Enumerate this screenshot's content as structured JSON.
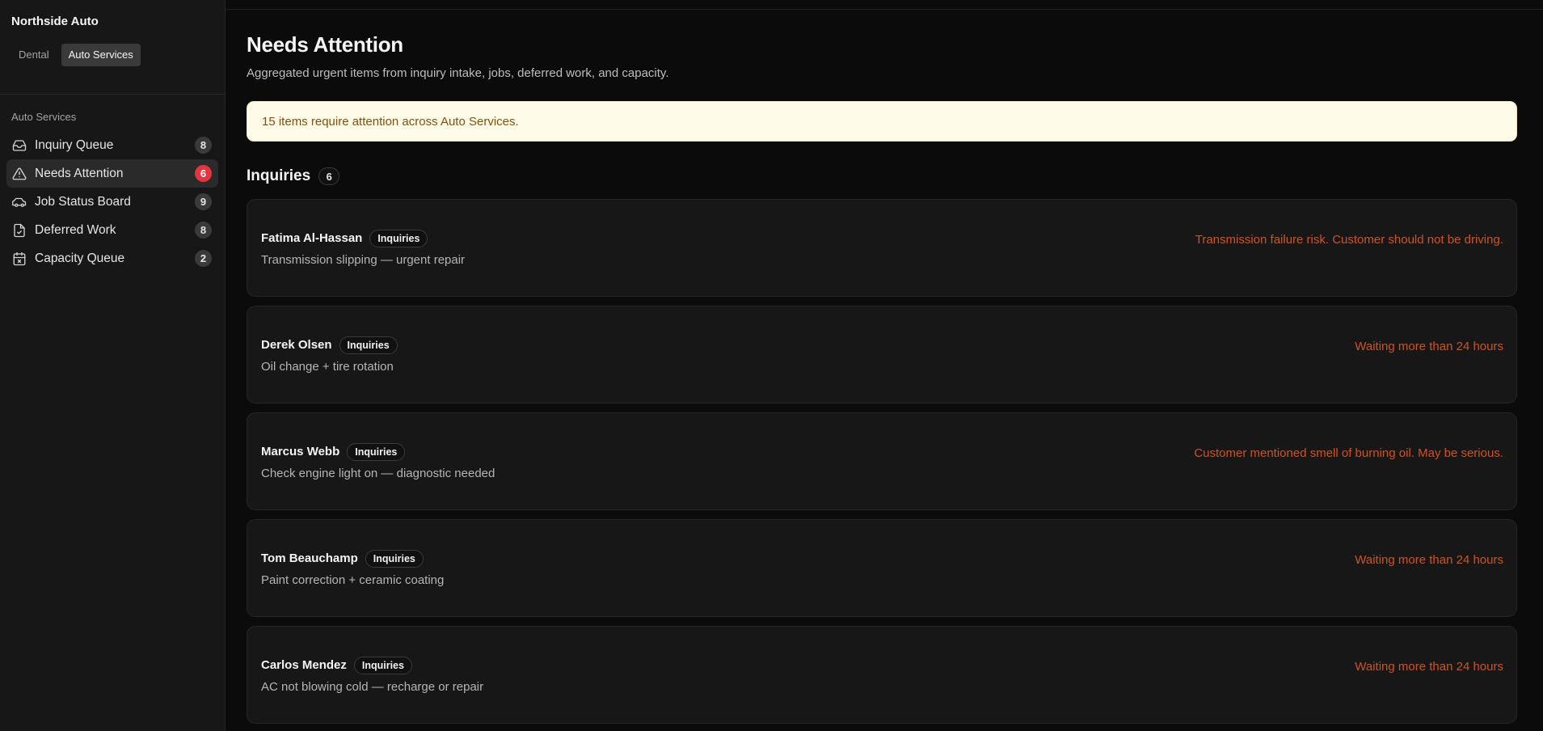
{
  "sidebar": {
    "brand": "Northside Auto",
    "switcher": [
      {
        "label": "Dental",
        "active": false
      },
      {
        "label": "Auto Services",
        "active": true
      }
    ],
    "group_label": "Auto Services",
    "items": [
      {
        "label": "Inquiry Queue",
        "count": "8",
        "icon": "inbox-icon",
        "active": false
      },
      {
        "label": "Needs Attention",
        "count": "6",
        "icon": "warning-triangle-icon",
        "active": true
      },
      {
        "label": "Job Status Board",
        "count": "9",
        "icon": "car-icon",
        "active": false
      },
      {
        "label": "Deferred Work",
        "count": "8",
        "icon": "file-check-icon",
        "active": false
      },
      {
        "label": "Capacity Queue",
        "count": "2",
        "icon": "calendar-icon",
        "active": false
      }
    ]
  },
  "main": {
    "title": "Needs Attention",
    "subtitle": "Aggregated urgent items from inquiry intake, jobs, deferred work, and capacity.",
    "banner": "15 items require attention across Auto Services.",
    "section": {
      "title": "Inquiries",
      "count": "6",
      "cards": [
        {
          "name": "Fatima Al-Hassan",
          "tag": "Inquiries",
          "description": "Transmission slipping — urgent repair",
          "reason": "Transmission failure risk. Customer should not be driving."
        },
        {
          "name": "Derek Olsen",
          "tag": "Inquiries",
          "description": "Oil change + tire rotation",
          "reason": "Waiting more than 24 hours"
        },
        {
          "name": "Marcus Webb",
          "tag": "Inquiries",
          "description": "Check engine light on — diagnostic needed",
          "reason": "Customer mentioned smell of burning oil. May be serious."
        },
        {
          "name": "Tom Beauchamp",
          "tag": "Inquiries",
          "description": "Paint correction + ceramic coating",
          "reason": "Waiting more than 24 hours"
        },
        {
          "name": "Carlos Mendez",
          "tag": "Inquiries",
          "description": "AC not blowing cold — recharge or repair",
          "reason": "Waiting more than 24 hours"
        }
      ]
    }
  },
  "colors": {
    "alert_badge": "#e5343f",
    "reason_text": "#d0531e",
    "banner_bg": "#fefce8",
    "banner_text": "#854d0e"
  }
}
